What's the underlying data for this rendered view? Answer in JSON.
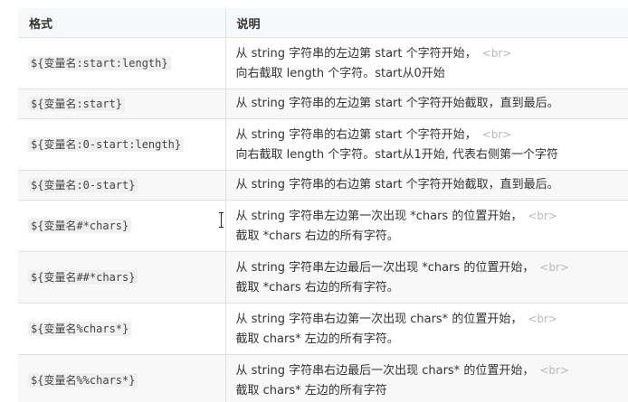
{
  "headers": {
    "format": "格式",
    "description": "说明"
  },
  "rows": [
    {
      "format": "${变量名:start:length}",
      "line1": "从 string 字符串的左边第 start 个字符开始，",
      "br": "<br>",
      "line2": "向右截取 length 个字符。start从0开始"
    },
    {
      "format": "${变量名:start}",
      "line1": "从 string 字符串的左边第 start 个字符开始截取，直到最后。"
    },
    {
      "format": "${变量名:0-start:length}",
      "line1": "从 string 字符串的右边第 start 个字符开始，",
      "br": "<br>",
      "line2": "向右截取 length 个字符。start从1开始, 代表右侧第一个字符"
    },
    {
      "format": "${变量名:0-start}",
      "line1": "从 string 字符串的右边第 start 个字符开始截取，直到最后。"
    },
    {
      "format": "${变量名#*chars}",
      "line1": "从 string 字符串左边第一次出现 *chars 的位置开始，",
      "br": "<br>",
      "line2": "截取 *chars 右边的所有字符。"
    },
    {
      "format": "${变量名##*chars}",
      "line1": "从 string 字符串左边最后一次出现 *chars 的位置开始，",
      "br": "<br>",
      "line2": "截取 *chars 右边的所有字符。"
    },
    {
      "format": "${变量名%chars*}",
      "line1": "从 string 字符串右边第一次出现 chars* 的位置开始，",
      "br": "<br>",
      "line2": "截取 chars* 左边的所有字符。"
    },
    {
      "format": "${变量名%%chars*}",
      "line1": "从 string 字符串右边最后一次出现 chars* 的位置开始，",
      "br": "<br>",
      "line2": "截取 chars* 左边的所有字符"
    }
  ]
}
